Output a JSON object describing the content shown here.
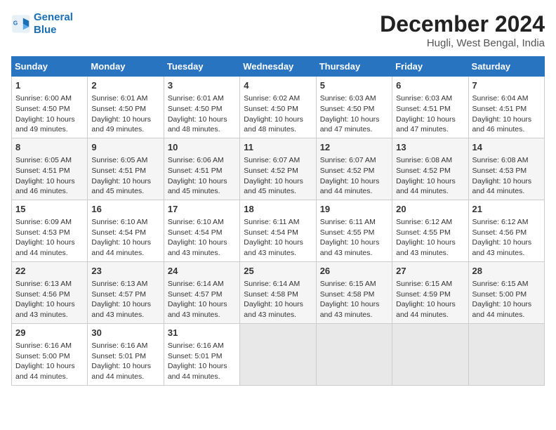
{
  "logo": {
    "line1": "General",
    "line2": "Blue"
  },
  "title": "December 2024",
  "location": "Hugli, West Bengal, India",
  "weekdays": [
    "Sunday",
    "Monday",
    "Tuesday",
    "Wednesday",
    "Thursday",
    "Friday",
    "Saturday"
  ],
  "weeks": [
    [
      {
        "day": 1,
        "info": "Sunrise: 6:00 AM\nSunset: 4:50 PM\nDaylight: 10 hours\nand 49 minutes."
      },
      {
        "day": 2,
        "info": "Sunrise: 6:01 AM\nSunset: 4:50 PM\nDaylight: 10 hours\nand 49 minutes."
      },
      {
        "day": 3,
        "info": "Sunrise: 6:01 AM\nSunset: 4:50 PM\nDaylight: 10 hours\nand 48 minutes."
      },
      {
        "day": 4,
        "info": "Sunrise: 6:02 AM\nSunset: 4:50 PM\nDaylight: 10 hours\nand 48 minutes."
      },
      {
        "day": 5,
        "info": "Sunrise: 6:03 AM\nSunset: 4:50 PM\nDaylight: 10 hours\nand 47 minutes."
      },
      {
        "day": 6,
        "info": "Sunrise: 6:03 AM\nSunset: 4:51 PM\nDaylight: 10 hours\nand 47 minutes."
      },
      {
        "day": 7,
        "info": "Sunrise: 6:04 AM\nSunset: 4:51 PM\nDaylight: 10 hours\nand 46 minutes."
      }
    ],
    [
      {
        "day": 8,
        "info": "Sunrise: 6:05 AM\nSunset: 4:51 PM\nDaylight: 10 hours\nand 46 minutes."
      },
      {
        "day": 9,
        "info": "Sunrise: 6:05 AM\nSunset: 4:51 PM\nDaylight: 10 hours\nand 45 minutes."
      },
      {
        "day": 10,
        "info": "Sunrise: 6:06 AM\nSunset: 4:51 PM\nDaylight: 10 hours\nand 45 minutes."
      },
      {
        "day": 11,
        "info": "Sunrise: 6:07 AM\nSunset: 4:52 PM\nDaylight: 10 hours\nand 45 minutes."
      },
      {
        "day": 12,
        "info": "Sunrise: 6:07 AM\nSunset: 4:52 PM\nDaylight: 10 hours\nand 44 minutes."
      },
      {
        "day": 13,
        "info": "Sunrise: 6:08 AM\nSunset: 4:52 PM\nDaylight: 10 hours\nand 44 minutes."
      },
      {
        "day": 14,
        "info": "Sunrise: 6:08 AM\nSunset: 4:53 PM\nDaylight: 10 hours\nand 44 minutes."
      }
    ],
    [
      {
        "day": 15,
        "info": "Sunrise: 6:09 AM\nSunset: 4:53 PM\nDaylight: 10 hours\nand 44 minutes."
      },
      {
        "day": 16,
        "info": "Sunrise: 6:10 AM\nSunset: 4:54 PM\nDaylight: 10 hours\nand 44 minutes."
      },
      {
        "day": 17,
        "info": "Sunrise: 6:10 AM\nSunset: 4:54 PM\nDaylight: 10 hours\nand 43 minutes."
      },
      {
        "day": 18,
        "info": "Sunrise: 6:11 AM\nSunset: 4:54 PM\nDaylight: 10 hours\nand 43 minutes."
      },
      {
        "day": 19,
        "info": "Sunrise: 6:11 AM\nSunset: 4:55 PM\nDaylight: 10 hours\nand 43 minutes."
      },
      {
        "day": 20,
        "info": "Sunrise: 6:12 AM\nSunset: 4:55 PM\nDaylight: 10 hours\nand 43 minutes."
      },
      {
        "day": 21,
        "info": "Sunrise: 6:12 AM\nSunset: 4:56 PM\nDaylight: 10 hours\nand 43 minutes."
      }
    ],
    [
      {
        "day": 22,
        "info": "Sunrise: 6:13 AM\nSunset: 4:56 PM\nDaylight: 10 hours\nand 43 minutes."
      },
      {
        "day": 23,
        "info": "Sunrise: 6:13 AM\nSunset: 4:57 PM\nDaylight: 10 hours\nand 43 minutes."
      },
      {
        "day": 24,
        "info": "Sunrise: 6:14 AM\nSunset: 4:57 PM\nDaylight: 10 hours\nand 43 minutes."
      },
      {
        "day": 25,
        "info": "Sunrise: 6:14 AM\nSunset: 4:58 PM\nDaylight: 10 hours\nand 43 minutes."
      },
      {
        "day": 26,
        "info": "Sunrise: 6:15 AM\nSunset: 4:58 PM\nDaylight: 10 hours\nand 43 minutes."
      },
      {
        "day": 27,
        "info": "Sunrise: 6:15 AM\nSunset: 4:59 PM\nDaylight: 10 hours\nand 44 minutes."
      },
      {
        "day": 28,
        "info": "Sunrise: 6:15 AM\nSunset: 5:00 PM\nDaylight: 10 hours\nand 44 minutes."
      }
    ],
    [
      {
        "day": 29,
        "info": "Sunrise: 6:16 AM\nSunset: 5:00 PM\nDaylight: 10 hours\nand 44 minutes."
      },
      {
        "day": 30,
        "info": "Sunrise: 6:16 AM\nSunset: 5:01 PM\nDaylight: 10 hours\nand 44 minutes."
      },
      {
        "day": 31,
        "info": "Sunrise: 6:16 AM\nSunset: 5:01 PM\nDaylight: 10 hours\nand 44 minutes."
      },
      null,
      null,
      null,
      null
    ]
  ]
}
